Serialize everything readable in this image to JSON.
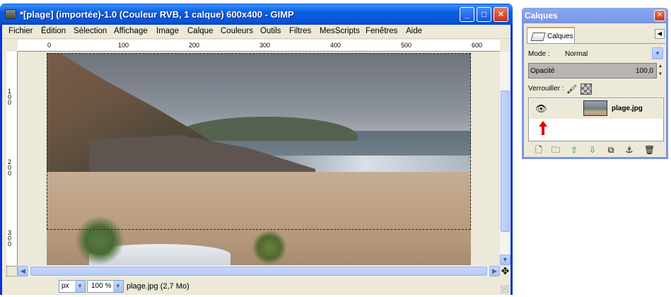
{
  "main_window": {
    "title": "*[plage] (importée)-1.0 (Couleur RVB, 1 calque) 600x400 - GIMP",
    "buttons": {
      "minimize": "_",
      "maximize": "□",
      "close": "✕"
    },
    "menu": [
      "Fichier",
      "Édition",
      "Sélection",
      "Affichage",
      "Image",
      "Calque",
      "Couleurs",
      "Outils",
      "Filtres",
      "MesScripts",
      "Fenêtres",
      "Aide"
    ],
    "ruler_top": [
      "0",
      "100",
      "200",
      "300",
      "400",
      "500",
      "600"
    ],
    "ruler_left": [
      "1\n0\n0",
      "2\n0\n0",
      "3\n0\n0"
    ],
    "status": {
      "unit": "px",
      "zoom": "100 %",
      "info": "plage.jpg (2,7 Mo)"
    }
  },
  "layers_dialog": {
    "title": "Calques",
    "tab_label": "Calques",
    "mode_label": "Mode :",
    "mode_value": "Normal",
    "opacity_label": "Opacité",
    "opacity_value": "100,0",
    "lock_label": "Verrouiller :",
    "layers": [
      {
        "name": "plage.jpg",
        "visible": true
      }
    ]
  },
  "colors": {
    "titlebar": "#0a5fdf",
    "selection": "#f5d000",
    "annotation_arrow": "#e00000"
  }
}
